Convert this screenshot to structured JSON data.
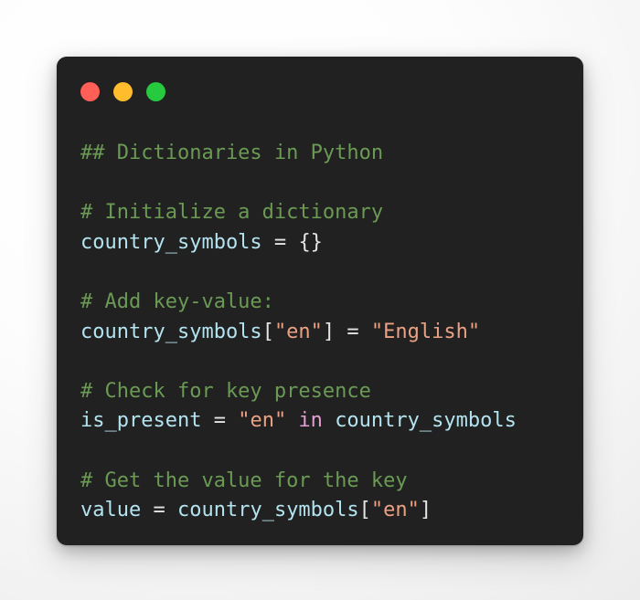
{
  "window": {
    "background_color": "#212121",
    "page_background_color": "#f4f4f4",
    "controls": [
      {
        "name": "close",
        "color": "#ff5f56"
      },
      {
        "name": "minimize",
        "color": "#ffbd2e"
      },
      {
        "name": "maximize",
        "color": "#27c93f"
      }
    ]
  },
  "theme": {
    "comment": "#6a9a54",
    "variable": "#b4e3f0",
    "punctuation": "#e4e4e4",
    "string": "#eaa184",
    "keyword": "#e49fd4"
  },
  "code": {
    "language": "python",
    "plain_text": "## Dictionaries in Python\n\n# Initialize a dictionary\ncountry_symbols = {}\n\n# Add key-value:\ncountry_symbols[\"en\"] = \"English\"\n\n# Check for key presence\nis_present = \"en\" in country_symbols\n\n# Get the value for the key\nvalue = country_symbols[\"en\"]",
    "lines": [
      {
        "id": "l1",
        "tokens": [
          {
            "t": "## Dictionaries in Python",
            "c": "comment"
          }
        ]
      },
      {
        "id": "l2",
        "tokens": []
      },
      {
        "id": "l3",
        "tokens": [
          {
            "t": "# Initialize a dictionary",
            "c": "comment"
          }
        ]
      },
      {
        "id": "l4",
        "tokens": [
          {
            "t": "country_symbols",
            "c": "var"
          },
          {
            "t": " = ",
            "c": "punct"
          },
          {
            "t": "{}",
            "c": "punct"
          }
        ]
      },
      {
        "id": "l5",
        "tokens": []
      },
      {
        "id": "l6",
        "tokens": [
          {
            "t": "# Add key-value:",
            "c": "comment"
          }
        ]
      },
      {
        "id": "l7",
        "tokens": [
          {
            "t": "country_symbols",
            "c": "var"
          },
          {
            "t": "[",
            "c": "punct"
          },
          {
            "t": "\"en\"",
            "c": "string"
          },
          {
            "t": "]",
            "c": "punct"
          },
          {
            "t": " = ",
            "c": "punct"
          },
          {
            "t": "\"English\"",
            "c": "string"
          }
        ]
      },
      {
        "id": "l8",
        "tokens": []
      },
      {
        "id": "l9",
        "tokens": [
          {
            "t": "# Check for key presence",
            "c": "comment"
          }
        ]
      },
      {
        "id": "l10",
        "tokens": [
          {
            "t": "is_present",
            "c": "var"
          },
          {
            "t": " = ",
            "c": "punct"
          },
          {
            "t": "\"en\"",
            "c": "string"
          },
          {
            "t": " ",
            "c": "punct"
          },
          {
            "t": "in",
            "c": "kw"
          },
          {
            "t": " ",
            "c": "punct"
          },
          {
            "t": "country_symbols",
            "c": "var"
          }
        ]
      },
      {
        "id": "l11",
        "tokens": []
      },
      {
        "id": "l12",
        "tokens": [
          {
            "t": "# Get the value for the key",
            "c": "comment"
          }
        ]
      },
      {
        "id": "l13",
        "tokens": [
          {
            "t": "value",
            "c": "var"
          },
          {
            "t": " = ",
            "c": "punct"
          },
          {
            "t": "country_symbols",
            "c": "var"
          },
          {
            "t": "[",
            "c": "punct"
          },
          {
            "t": "\"en\"",
            "c": "string"
          },
          {
            "t": "]",
            "c": "punct"
          }
        ]
      }
    ]
  }
}
